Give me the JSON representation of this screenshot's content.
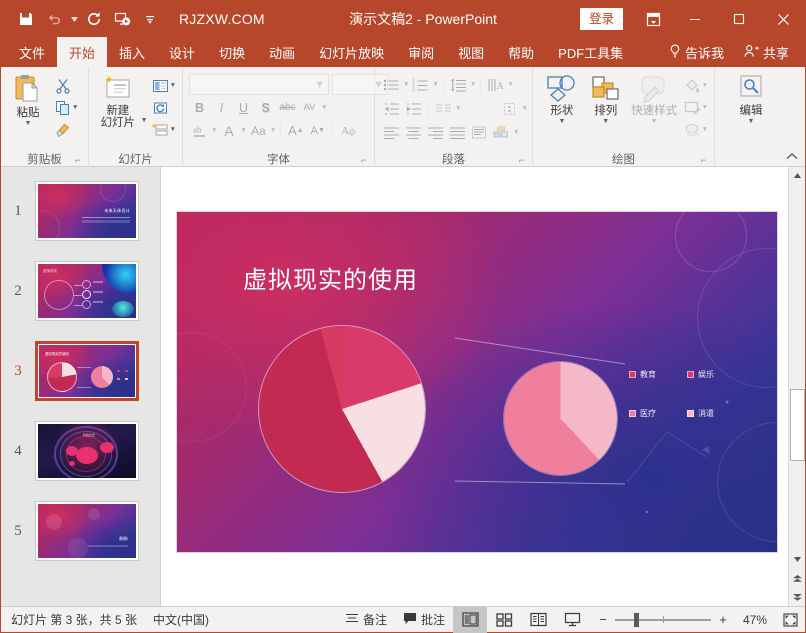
{
  "titlebar": {
    "brand": "RJZXW.COM",
    "document_title": "演示文稿2  -  PowerPoint",
    "signin_label": "登录",
    "qat": [
      {
        "name": "save-icon",
        "label": "保存"
      },
      {
        "name": "undo-icon",
        "label": "撤消"
      },
      {
        "name": "redo-icon",
        "label": "恢复"
      },
      {
        "name": "start-slideshow-icon",
        "label": "从头开始"
      },
      {
        "name": "customize-qat-icon",
        "label": "自定义快速访问工具栏"
      }
    ],
    "window_buttons": {
      "ribbon_display": "功能区显示选项",
      "minimize": "最小化",
      "maximize": "最大化",
      "close": "关闭"
    }
  },
  "tabs": [
    {
      "label": "文件",
      "active": false
    },
    {
      "label": "开始",
      "active": true
    },
    {
      "label": "插入",
      "active": false
    },
    {
      "label": "设计",
      "active": false
    },
    {
      "label": "切换",
      "active": false
    },
    {
      "label": "动画",
      "active": false
    },
    {
      "label": "幻灯片放映",
      "active": false
    },
    {
      "label": "审阅",
      "active": false
    },
    {
      "label": "视图",
      "active": false
    },
    {
      "label": "帮助",
      "active": false
    },
    {
      "label": "PDF工具集",
      "active": false
    }
  ],
  "tellme_label": "告诉我",
  "share_label": "共享",
  "ribbon": {
    "groups": [
      {
        "name": "clipboard",
        "label": "剪贴板"
      },
      {
        "name": "slides",
        "label": "幻灯片"
      },
      {
        "name": "font",
        "label": "字体"
      },
      {
        "name": "paragraph",
        "label": "段落"
      },
      {
        "name": "drawing",
        "label": "绘图"
      },
      {
        "name": "editing",
        "label": ""
      }
    ],
    "clipboard": {
      "paste_label": "粘贴",
      "cut_label": "剪切",
      "copy_label": "复制",
      "format_painter_label": "格式刷"
    },
    "slides": {
      "new_slide_label": "新建\n幻灯片",
      "new_slide_line1": "新建",
      "new_slide_line2": "幻灯片",
      "layout_label": "版式",
      "reset_label": "重置",
      "section_label": "节"
    },
    "font": {
      "name_value": "",
      "name_placeholder": "",
      "size_value": "",
      "bold": "B",
      "italic": "I",
      "underline": "U",
      "shadow": "S",
      "strikethrough": "abc",
      "spacing": "AV",
      "char_case": "Aa",
      "grow": "A",
      "shrink": "A",
      "clear_format": "清除所有格式",
      "font_color": "A"
    },
    "paragraph": {
      "bullets": "项目符号",
      "numbering": "编号",
      "line_spacing": "行距",
      "text_direction": "文字方向",
      "decrease_indent": "减少缩进量",
      "increase_indent": "增加缩进量",
      "align_left": "左对齐",
      "align_center": "居中",
      "align_right": "右对齐",
      "justify": "两端对齐",
      "columns": "分栏",
      "align_text": "对齐文本",
      "smartart": "转换为 SmartArt"
    },
    "drawing": {
      "shapes_label": "形状",
      "arrange_label": "排列",
      "quickstyles_label": "快速样式",
      "shape_fill": "形状填充",
      "shape_outline": "形状轮廓",
      "shape_effects": "形状效果"
    },
    "editing": {
      "edit_label": "编辑"
    },
    "collapse_label": "折叠功能区"
  },
  "thumbnails": [
    {
      "number": "1",
      "selected": false,
      "theme": "galaxy",
      "title": "未来天体设计"
    },
    {
      "number": "2",
      "selected": false,
      "theme": "galaxy",
      "title": "虚拟现实"
    },
    {
      "number": "3",
      "selected": true,
      "theme": "galaxy",
      "title": "虚拟现实的使用"
    },
    {
      "number": "4",
      "selected": false,
      "theme": "dark",
      "title": "科技论文"
    },
    {
      "number": "5",
      "selected": false,
      "theme": "galaxy",
      "title": "谢谢!"
    }
  ],
  "slide": {
    "title": "虚拟现实的使用"
  },
  "chart_data": {
    "type": "pie",
    "title": "虚拟现实的使用",
    "charts": [
      {
        "name": "main-pie",
        "labels": [
          "教育",
          "娱乐",
          "医疗",
          "消遣"
        ],
        "values": [
          52,
          20,
          22,
          6
        ],
        "colors": [
          "#c32a52",
          "#da3a69",
          "#f7dfe3",
          "#d53a62"
        ]
      },
      {
        "name": "detail-pie",
        "labels": [
          "医疗",
          "消遣"
        ],
        "values": [
          62,
          38
        ],
        "colors": [
          "#ef7f9c",
          "#f4b8c8"
        ]
      }
    ],
    "legend": [
      {
        "label": "教育",
        "color": "#c32a52"
      },
      {
        "label": "娱乐",
        "color": "#da3a69"
      },
      {
        "label": "医疗",
        "color": "#ef7f9c"
      },
      {
        "label": "消遣",
        "color": "#f4b8c8"
      }
    ],
    "legend_position": "right"
  },
  "statusbar": {
    "slide_count": "幻灯片 第 3 张，共 5 张",
    "language": "中文(中国)",
    "notes_label": "备注",
    "comments_label": "批注",
    "views": [
      {
        "name": "normal-view",
        "label": "普通视图",
        "active": true
      },
      {
        "name": "slide-sorter-view",
        "label": "幻灯片浏览",
        "active": false
      },
      {
        "name": "reading-view",
        "label": "阅读视图",
        "active": false
      },
      {
        "name": "slideshow-view",
        "label": "幻灯片放映",
        "active": false
      }
    ],
    "zoom_out": "−",
    "zoom_in": "+",
    "zoom_level": "47%",
    "fit_label": "使幻灯片适应当前窗口"
  },
  "colors": {
    "accent": "#b7472a",
    "ribbon_bg": "#f3f2f1",
    "thumbpane_bg": "#e6e6e6",
    "selection": "#c0452a"
  }
}
